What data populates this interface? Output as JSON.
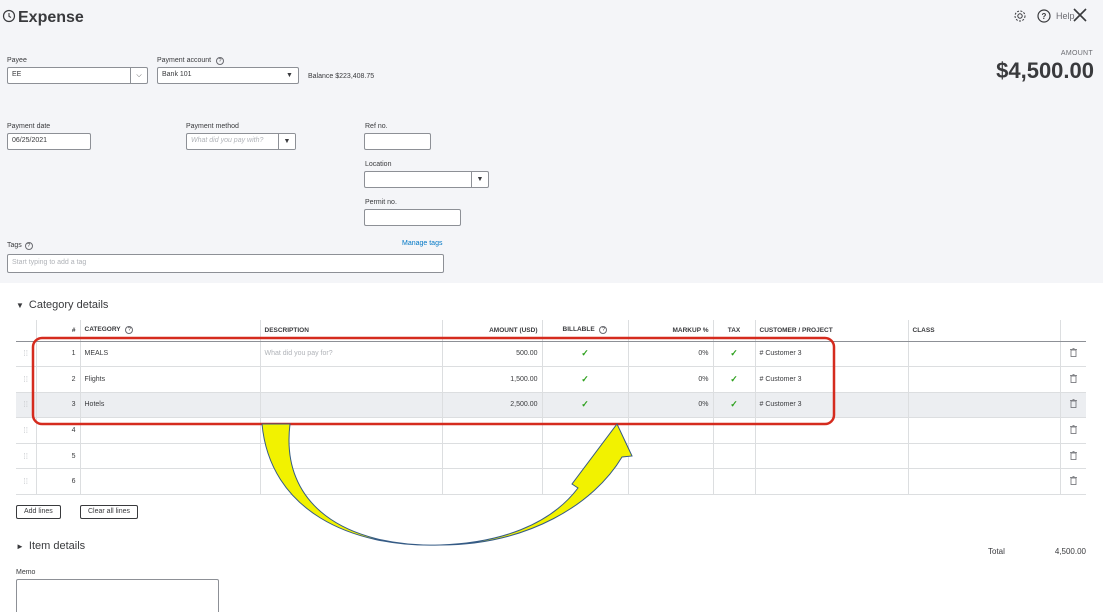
{
  "header": {
    "title": "Expense",
    "help_label": "Help"
  },
  "payee": {
    "label": "Payee",
    "value": "EE"
  },
  "payment_account": {
    "label": "Payment account",
    "value": "Bank 101",
    "balance": "Balance $223,408.75"
  },
  "amount": {
    "label": "AMOUNT",
    "value": "$4,500.00"
  },
  "payment_date": {
    "label": "Payment date",
    "value": "06/25/2021"
  },
  "payment_method": {
    "label": "Payment method",
    "placeholder": "What did you pay with?"
  },
  "ref_no": {
    "label": "Ref no.",
    "value": ""
  },
  "location": {
    "label": "Location",
    "value": ""
  },
  "permit_no": {
    "label": "Permit no.",
    "value": ""
  },
  "tags": {
    "label": "Tags",
    "placeholder": "Start typing to add a tag",
    "manage_label": "Manage tags"
  },
  "category_details": {
    "title": "Category details",
    "columns": [
      "#",
      "CATEGORY",
      "DESCRIPTION",
      "AMOUNT (USD)",
      "BILLABLE",
      "MARKUP %",
      "TAX",
      "CUSTOMER / PROJECT",
      "CLASS"
    ],
    "description_placeholder": "What did you pay for?",
    "rows": [
      {
        "num": "1",
        "category": "MEALS",
        "description": "",
        "amount": "500.00",
        "billable": "✓",
        "markup": "0%",
        "tax": "✓",
        "customer": "# Customer 3",
        "class": ""
      },
      {
        "num": "2",
        "category": "Flights",
        "description": "",
        "amount": "1,500.00",
        "billable": "✓",
        "markup": "0%",
        "tax": "✓",
        "customer": "# Customer 3",
        "class": ""
      },
      {
        "num": "3",
        "category": "Hotels",
        "description": "",
        "amount": "2,500.00",
        "billable": "✓",
        "markup": "0%",
        "tax": "✓",
        "customer": "# Customer 3",
        "class": ""
      },
      {
        "num": "4",
        "category": "",
        "description": "",
        "amount": "",
        "billable": "",
        "markup": "",
        "tax": "",
        "customer": "",
        "class": ""
      },
      {
        "num": "5",
        "category": "",
        "description": "",
        "amount": "",
        "billable": "",
        "markup": "",
        "tax": "",
        "customer": "",
        "class": ""
      },
      {
        "num": "6",
        "category": "",
        "description": "",
        "amount": "",
        "billable": "",
        "markup": "",
        "tax": "",
        "customer": "",
        "class": ""
      }
    ],
    "add_lines_label": "Add lines",
    "clear_lines_label": "Clear all lines"
  },
  "item_details": {
    "title": "Item details"
  },
  "total": {
    "label": "Total",
    "value": "4,500.00"
  },
  "memo": {
    "label": "Memo",
    "value": ""
  },
  "colors": {
    "accent_green": "#2ca01c",
    "highlight_red": "#d52b1e",
    "arrow_yellow": "#f2f200",
    "link_blue": "#0077c5"
  }
}
